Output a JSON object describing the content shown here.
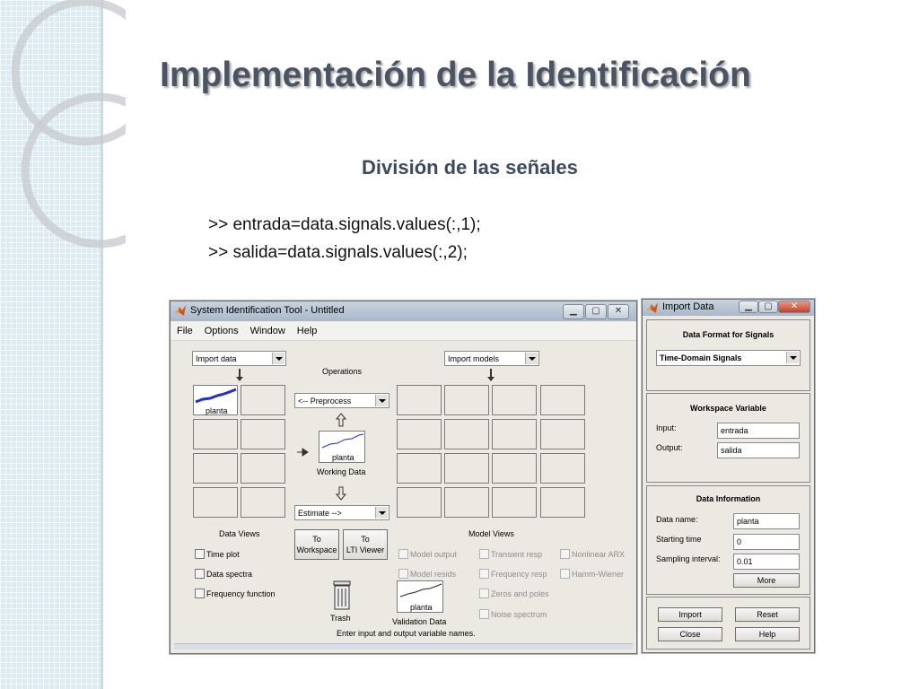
{
  "slide": {
    "title": "Implementación de la Identificación",
    "subtitle": "División de las señales",
    "code": [
      ">> entrada=data.signals.values(:,1);",
      ">> salida=data.signals.values(:,2);"
    ]
  },
  "ident_window": {
    "title": "System Identification Tool - Untitled",
    "menu": [
      "File",
      "Options",
      "Window",
      "Help"
    ],
    "import_data_select": "Import data",
    "import_models_select": "Import models",
    "operations_label": "Operations",
    "preprocess_select": "<-- Preprocess",
    "estimate_select": "Estimate -->",
    "data_item_label": "planta",
    "working_data_item": "planta",
    "working_data_label": "Working Data",
    "data_views_label": "Data Views",
    "model_views_label": "Model Views",
    "to_workspace": [
      "To",
      "Workspace"
    ],
    "to_lti_viewer": [
      "To",
      "LTI Viewer"
    ],
    "data_views": [
      "Time plot",
      "Data spectra",
      "Frequency function"
    ],
    "model_views_col1": [
      "Model output",
      "Model resids"
    ],
    "model_views_col2": [
      "Transient resp",
      "Frequency resp",
      "Zeros and poles",
      "Noise spectrum"
    ],
    "model_views_col3": [
      "Nonlinear ARX",
      "Hamm-Wiener"
    ],
    "trash_label": "Trash",
    "validation_item": "planta",
    "validation_label": "Validation Data",
    "status": "Enter input and output variable names."
  },
  "import_window": {
    "title": "Import Data",
    "format_panel_title": "Data Format for Signals",
    "format_select": "Time-Domain Signals",
    "workspace_panel_title": "Workspace Variable",
    "input_label": "Input:",
    "input_value": "entrada",
    "output_label": "Output:",
    "output_value": "salida",
    "info_panel_title": "Data Information",
    "data_name_label": "Data name:",
    "data_name_value": "planta",
    "start_label": "Starting time",
    "start_value": "0",
    "interval_label": "Sampling interval:",
    "interval_value": "0.01",
    "more_button": "More",
    "import_button": "Import",
    "reset_button": "Reset",
    "close_button": "Close",
    "help_button": "Help"
  }
}
